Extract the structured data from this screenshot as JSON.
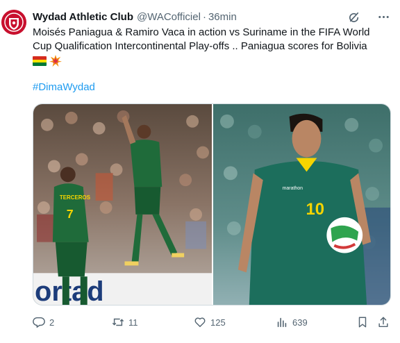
{
  "tweet": {
    "display_name": "Wydad Athletic Club",
    "handle": "@WACofficiel",
    "separator": "·",
    "time": "36min",
    "text": "Moisés Paniagua & Ramiro Vaca in action vs Suriname in the FIFA World Cup Qualification Intercontinental Play-offs .. Paniagua scores for Bolivia",
    "emojis": [
      "bolivia-flag",
      "collision"
    ],
    "hashtag": "#DimaWydad",
    "photos": {
      "left": {
        "shirt_name": "TERCEROS",
        "shirt_number": "7",
        "board_text": "ortad"
      },
      "right": {
        "shirt_number": "10",
        "brand": "marathon"
      }
    },
    "stats": {
      "replies": "2",
      "retweets": "11",
      "likes": "125",
      "views": "639"
    }
  },
  "icons": [
    "grok-icon",
    "more-icon",
    "reply-icon",
    "retweet-icon",
    "like-icon",
    "views-icon",
    "bookmark-icon",
    "share-icon"
  ],
  "colors": {
    "accent": "#1d9bf0",
    "muted": "#536471",
    "text": "#0f1419",
    "bolivia_jersey": "#1f6b3a",
    "club_red": "#c8102e"
  }
}
